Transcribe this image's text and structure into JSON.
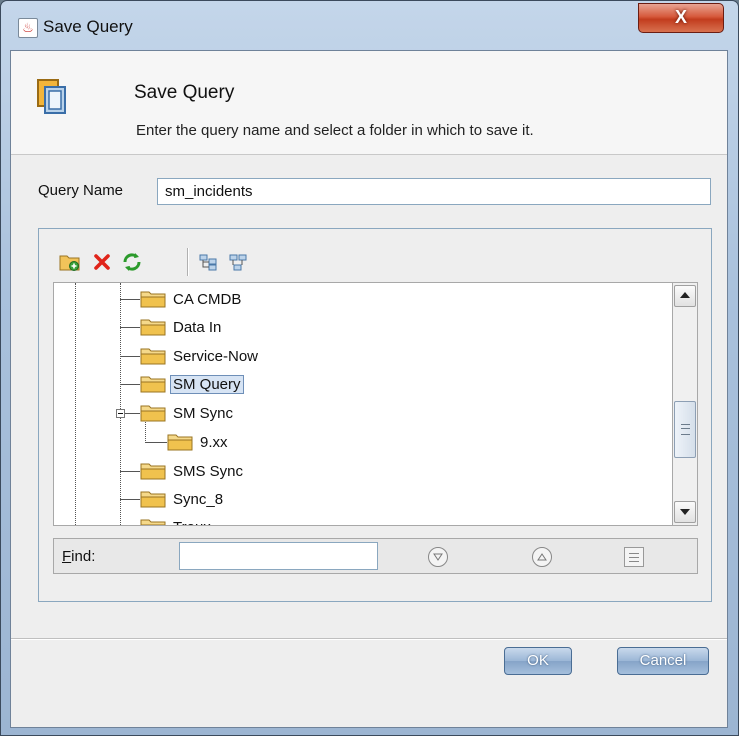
{
  "window": {
    "title": "Save Query",
    "close_label": "X"
  },
  "header": {
    "title": "Save Query",
    "description": "Enter the query name and select a folder in which to save it."
  },
  "form": {
    "query_name_label": "Query Name",
    "query_name_value": "sm_incidents"
  },
  "toolbar": {
    "buttons": [
      "new-folder-icon",
      "delete-icon",
      "refresh-icon",
      "expand-all-icon",
      "collapse-all-icon"
    ]
  },
  "tree": {
    "items": [
      {
        "label": "CA CMDB",
        "selected": false
      },
      {
        "label": "Data In",
        "selected": false
      },
      {
        "label": "Service-Now",
        "selected": false
      },
      {
        "label": "SM Query",
        "selected": true
      },
      {
        "label": "SM Sync",
        "selected": false,
        "expanded": true
      },
      {
        "label": "9.xx",
        "selected": false,
        "child_of": "SM Sync"
      },
      {
        "label": "SMS Sync",
        "selected": false
      },
      {
        "label": "Sync_8",
        "selected": false
      },
      {
        "label": "Troux",
        "selected": false
      }
    ]
  },
  "find": {
    "label_rest": "ind:",
    "label_mnemonic": "F",
    "value": ""
  },
  "buttons": {
    "ok": "OK",
    "cancel": "Cancel"
  }
}
